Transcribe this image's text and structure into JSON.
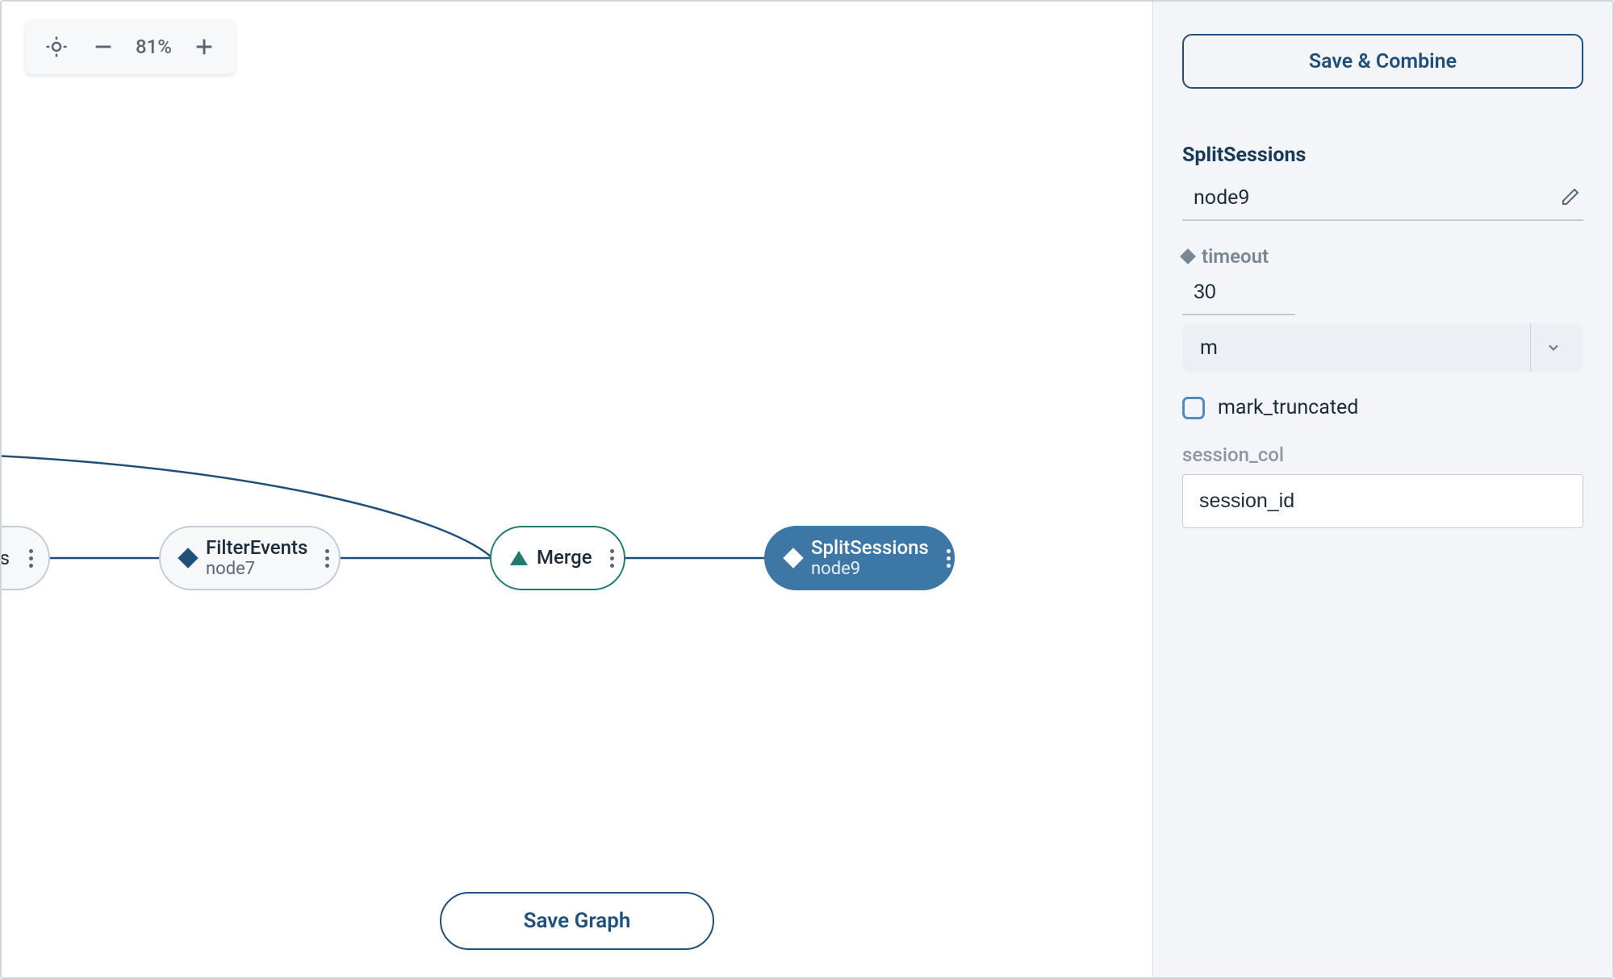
{
  "toolbar": {
    "zoom_level": "81%"
  },
  "footer": {
    "save_graph_label": "Save Graph"
  },
  "canvas": {
    "partial_node_suffix": "s",
    "nodes": {
      "filter_events": {
        "title": "FilterEvents",
        "subtitle": "node7"
      },
      "merge": {
        "title": "Merge"
      },
      "split_sessions": {
        "title": "SplitSessions",
        "subtitle": "node9"
      }
    }
  },
  "panel": {
    "save_combine_label": "Save & Combine",
    "node_type": "SplitSessions",
    "node_name": "node9",
    "timeout": {
      "label": "timeout",
      "value": "30",
      "unit": "m"
    },
    "mark_truncated": {
      "label": "mark_truncated",
      "checked": false
    },
    "session_col": {
      "label": "session_col",
      "value": "session_id"
    }
  }
}
